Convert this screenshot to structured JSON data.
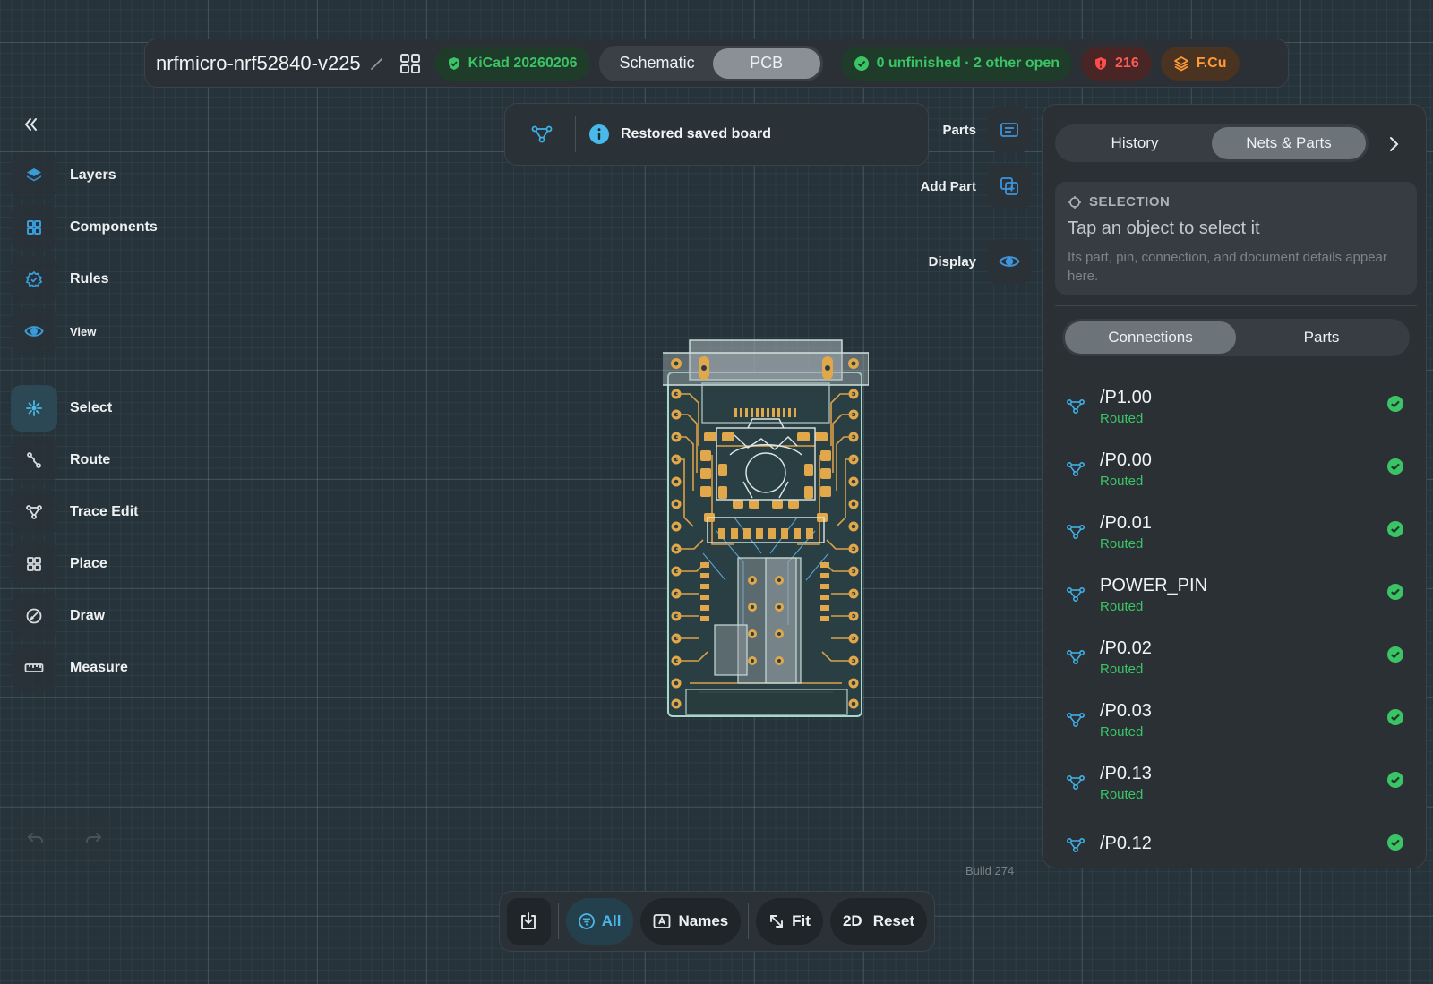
{
  "header": {
    "project_name": "nrfmicro-nrf52840-v225",
    "kicad_version": "KiCad 20260206",
    "view_tabs": [
      {
        "label": "Schematic",
        "active": false
      },
      {
        "label": "PCB",
        "active": true
      }
    ],
    "route_status": "0 unfinished · 2 other open",
    "error_count": "216",
    "active_layer": "F.Cu"
  },
  "toast": {
    "message": "Restored saved board"
  },
  "left_tools": {
    "top": [
      {
        "label": "Layers",
        "icon": "layers-icon"
      },
      {
        "label": "Components",
        "icon": "components-icon"
      },
      {
        "label": "Rules",
        "icon": "rules-icon"
      },
      {
        "label": "View",
        "icon": "eye-icon"
      }
    ],
    "modes": [
      {
        "label": "Select",
        "icon": "select-icon",
        "active": true
      },
      {
        "label": "Route",
        "icon": "route-icon"
      },
      {
        "label": "Trace Edit",
        "icon": "trace-edit-icon"
      },
      {
        "label": "Place",
        "icon": "place-icon"
      },
      {
        "label": "Draw",
        "icon": "draw-icon"
      },
      {
        "label": "Measure",
        "icon": "ruler-icon"
      }
    ]
  },
  "fab": {
    "parts_label": "Parts",
    "add_part_label": "Add Part",
    "display_label": "Display"
  },
  "panel": {
    "tabs": [
      {
        "label": "History",
        "active": false
      },
      {
        "label": "Nets & Parts",
        "active": true
      }
    ],
    "selection": {
      "heading": "SELECTION",
      "title": "Tap an object to select it",
      "description": "Its part, pin, connection, and document details appear here."
    },
    "sub_tabs": [
      {
        "label": "Connections",
        "active": true
      },
      {
        "label": "Parts",
        "active": false
      }
    ],
    "nets": [
      {
        "name": "/P1.00",
        "status": "Routed"
      },
      {
        "name": "/P0.00",
        "status": "Routed"
      },
      {
        "name": "/P0.01",
        "status": "Routed"
      },
      {
        "name": "POWER_PIN",
        "status": "Routed"
      },
      {
        "name": "/P0.02",
        "status": "Routed"
      },
      {
        "name": "/P0.03",
        "status": "Routed"
      },
      {
        "name": "/P0.13",
        "status": "Routed"
      },
      {
        "name": "/P0.12",
        "status": ""
      }
    ]
  },
  "build_label": "Build 274",
  "bottom_bar": {
    "all_label": "All",
    "names_label": "Names",
    "fit_label": "Fit",
    "mode_label": "2D",
    "reset_label": "Reset"
  },
  "colors": {
    "accent_blue": "#4bb7e8",
    "success_green": "#3bc466",
    "error_red": "#ff5a55",
    "layer_orange": "#ff9a38",
    "copper": "#e0a84a"
  }
}
